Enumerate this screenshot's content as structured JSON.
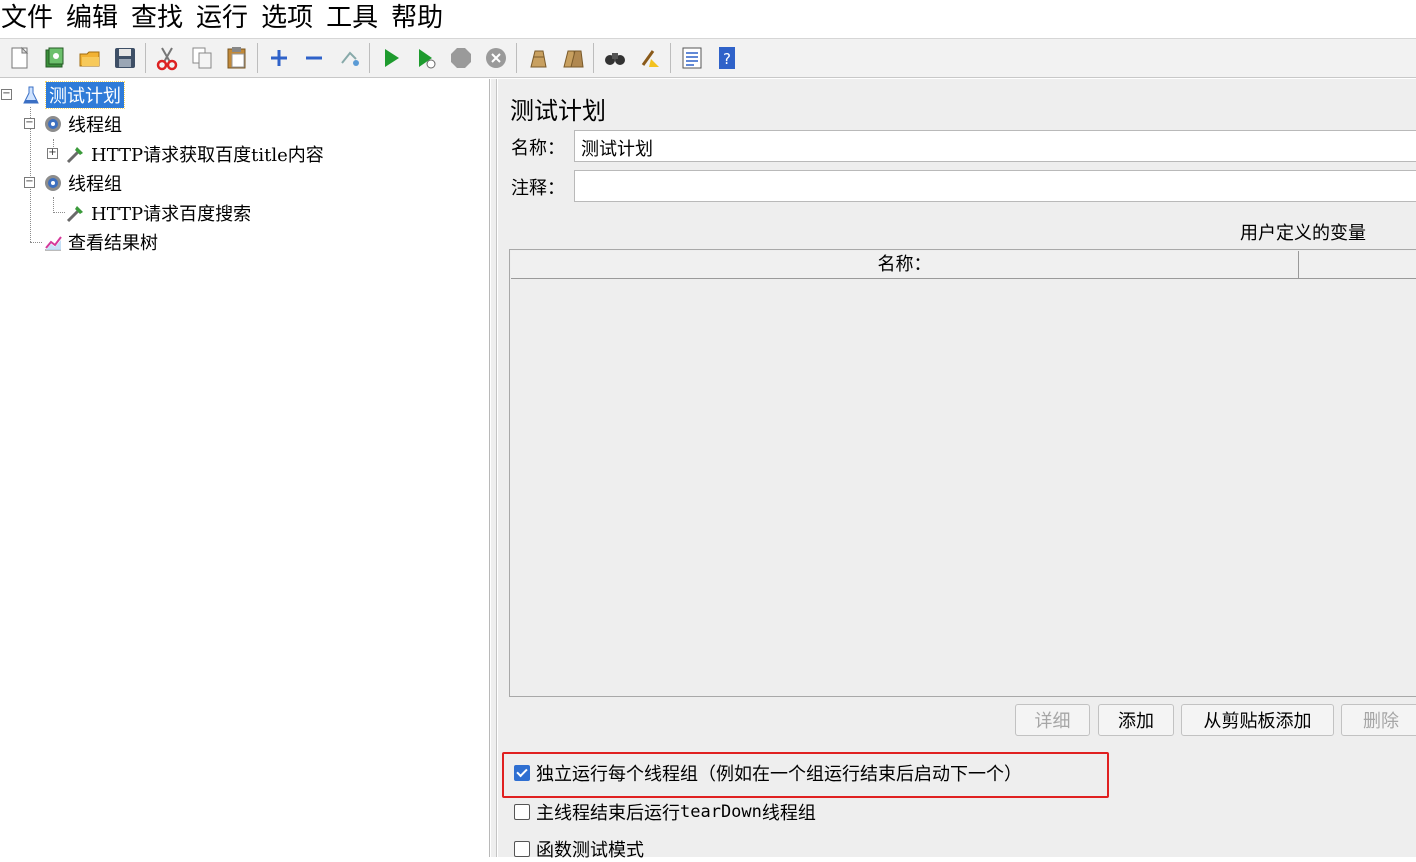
{
  "menubar": {
    "items": [
      "文件",
      "编辑",
      "查找",
      "运行",
      "选项",
      "工具",
      "帮助"
    ]
  },
  "toolbar": {
    "buttons": [
      "new-icon",
      "templates-icon",
      "open-icon",
      "save-icon",
      "cut-icon",
      "copy-icon",
      "paste-icon",
      "expand-icon",
      "collapse-icon",
      "toggle-icon",
      "start-icon",
      "start-no-pause-icon",
      "stop-icon",
      "shutdown-icon",
      "clear-icon",
      "clear-all-icon",
      "search-icon",
      "reset-search-icon",
      "function-helper-icon",
      "help-icon"
    ]
  },
  "tree": {
    "root": "测试计划",
    "thread_group_1": "线程组",
    "sampler_1": "HTTP请求获取百度title内容",
    "thread_group_2": "线程组",
    "sampler_2": "HTTP请求百度搜索",
    "listener": "查看结果树"
  },
  "panel": {
    "title": "测试计划",
    "name_label": "名称：",
    "name_value": "测试计划",
    "comment_label": "注释：",
    "comment_value": "",
    "udv_label": "用户定义的变量",
    "table_col_name": "名称：",
    "buttons": {
      "detail": "详细",
      "add": "添加",
      "add_clipboard": "从剪贴板添加",
      "delete": "删除"
    },
    "checkboxes": {
      "serialize": "独立运行每个线程组（例如在一个组运行结束后启动下一个）",
      "teardown_prefix": "主线程结束后运行 ",
      "teardown_mono": "tearDown",
      "teardown_suffix": " 线程组",
      "functional": "函数测试模式"
    }
  },
  "colors": {
    "selection": "#2f7bd8",
    "highlight": "#e02020",
    "checkbox_checked": "#2f6fd1"
  }
}
